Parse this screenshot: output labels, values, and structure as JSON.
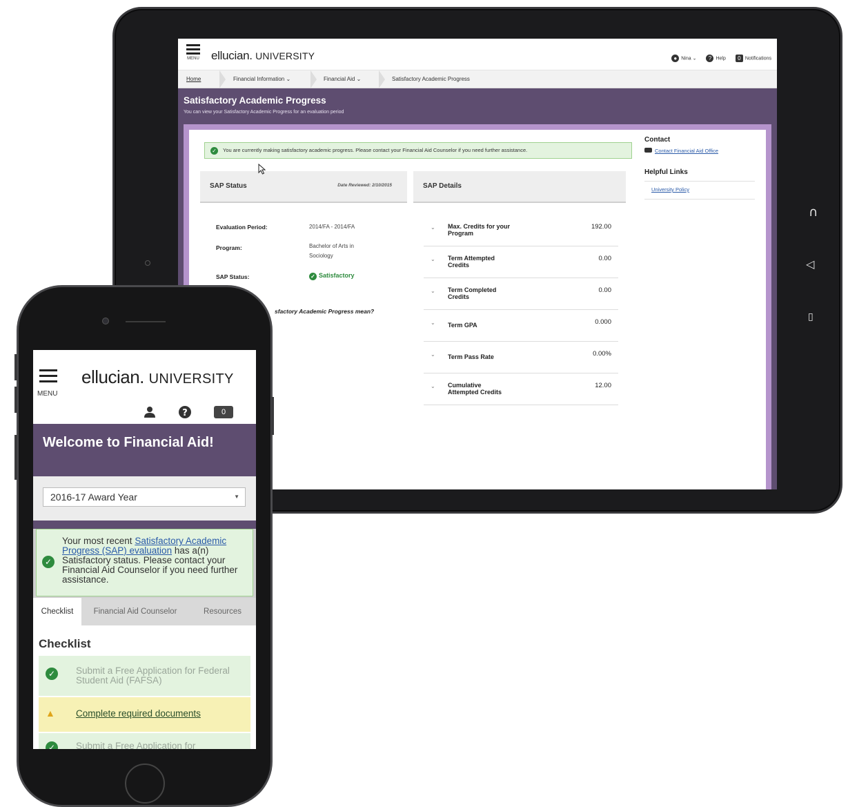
{
  "tablet": {
    "app": {
      "logo_brand": "ellucian.",
      "logo_suffix": "UNIVERSITY",
      "menu_label": "MENU"
    },
    "user_bar": {
      "user": "Nina",
      "help": "Help",
      "notifications": "Notifications"
    },
    "breadcrumb": [
      "Home",
      "Financial Information",
      "Financial Aid",
      "Satisfactory Academic Progress"
    ],
    "page": {
      "title": "Satisfactory Academic Progress",
      "subtitle": "You can view your Satisfactory Academic Progress for an evaluation period"
    },
    "alert": "You are currently making satisfactory academic progress. Please contact your Financial Aid Counselor if you need further assistance.",
    "sap_status": {
      "heading": "SAP Status",
      "date_reviewed": "Date Reviewed: 2/10/2015",
      "evaluation_period_label": "Evaluation Period:",
      "evaluation_period_value": "2014/FA - 2014/FA",
      "program_label": "Program:",
      "program_value_1": "Bachelor of Arts in",
      "program_value_2": "Sociology",
      "status_label": "SAP Status:",
      "status_value": "Satisfactory",
      "question": "What does Satisfactory Academic Progress mean?",
      "question_visible": "sfactory Academic Progress mean?"
    },
    "sap_details": {
      "heading": "SAP Details",
      "rows": [
        {
          "line1": "Max. Credits for your",
          "line2": "Program",
          "value": "192.00"
        },
        {
          "line1": "Term Attempted",
          "line2": "Credits",
          "value": "0.00"
        },
        {
          "line1": "Term Completed",
          "line2": "Credits",
          "value": "0.00"
        },
        {
          "line1": "Term GPA",
          "line2": "",
          "value": "0.000"
        },
        {
          "line1": "Term Pass Rate",
          "line2": "",
          "value": "0.00%"
        },
        {
          "line1": "Cumulative",
          "line2": "Attempted Credits",
          "value": "12.00"
        }
      ]
    },
    "sidebar": {
      "contact_heading": "Contact",
      "contact_link": "Contact Financial Aid Office",
      "links_heading": "Helpful Links",
      "policy_link": "University Policy"
    }
  },
  "phone": {
    "app": {
      "logo_brand": "ellucian.",
      "logo_suffix": "UNIVERSITY",
      "menu_label": "MENU"
    },
    "notification_count": "0",
    "welcome": "Welcome to Financial Aid!",
    "award_year": "2016-17 Award Year",
    "alert": {
      "prefix": "Your most recent ",
      "link": "Satisfactory Academic Progress (SAP) evaluation",
      "suffix": " has a(n) Satisfactory status. Please contact your Financial Aid Counselor if you need further assistance."
    },
    "tabs": [
      "Checklist",
      "Financial Aid Counselor",
      "Resources"
    ],
    "checklist_heading": "Checklist",
    "checklist": [
      {
        "status": "done",
        "text": "Submit a Free Application for Federal Student Aid (FAFSA)"
      },
      {
        "status": "todo",
        "text": "Complete required documents"
      },
      {
        "status": "done",
        "text": "Submit a Free Application for"
      }
    ]
  },
  "icons": {
    "check": "check-circle-icon",
    "warning": "warning-icon",
    "user": "user-icon",
    "help": "help-icon",
    "notifications": "notification-icon",
    "menu": "hamburger-menu-icon",
    "chevron": "chevron-down-icon"
  },
  "colors": {
    "brand_purple": "#5e4d70",
    "panel_lilac": "#b594cc",
    "success_green": "#2e8b3e",
    "alert_bg": "#e3f3df",
    "warning_bg": "#f7f1b5",
    "link_blue": "#2a5aa8"
  }
}
